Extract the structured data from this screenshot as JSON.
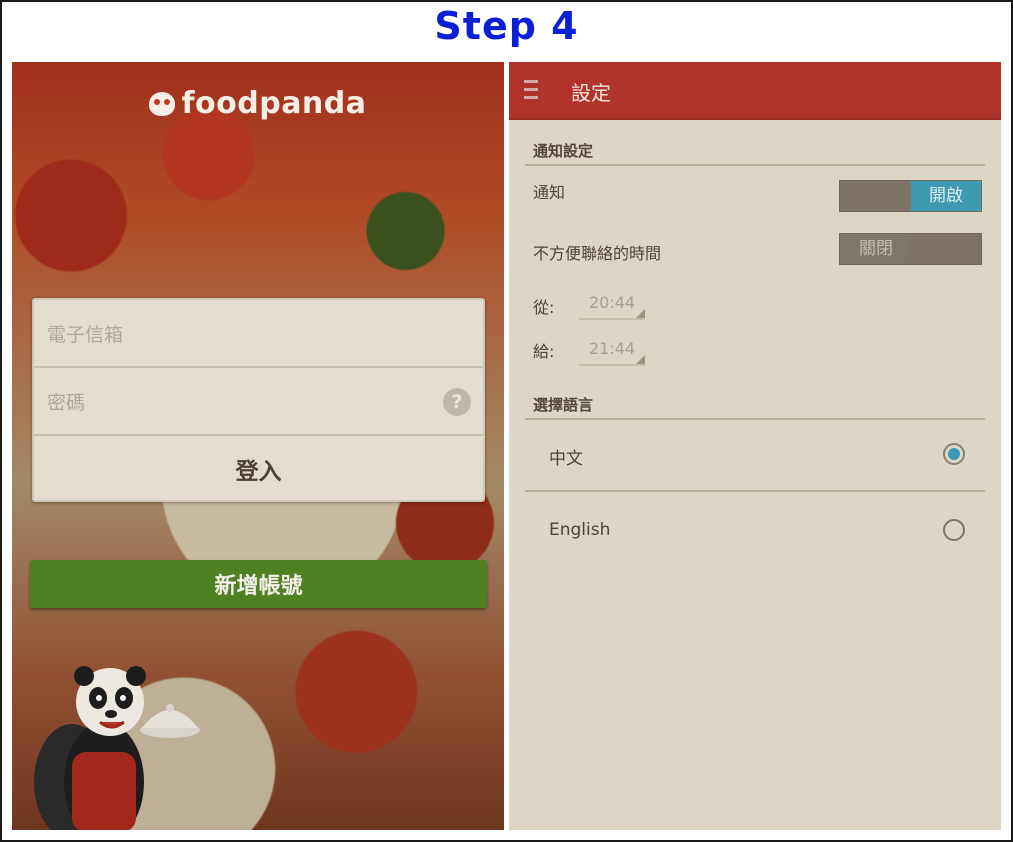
{
  "header": {
    "step_title": "Step 4"
  },
  "login": {
    "logo_text": "foodpanda",
    "email_placeholder": "電子信箱",
    "password_placeholder": "密碼",
    "help_icon_glyph": "?",
    "login_label": "登入",
    "signup_label": "新增帳號"
  },
  "settings": {
    "title": "設定",
    "notification_section": "通知設定",
    "notification_label": "通知",
    "notification_toggle": "開啟",
    "quiet_hours_label": "不方便聯絡的時間",
    "quiet_hours_toggle": "關閉",
    "from_label": "從:",
    "from_time": "20:44",
    "to_label": "給:",
    "to_time": "21:44",
    "language_section": "選擇語言",
    "languages": [
      {
        "label": "中文",
        "selected": true
      },
      {
        "label": "English",
        "selected": false
      }
    ]
  },
  "colors": {
    "step_title": "#0b1fd6",
    "appbar": "#b0332b",
    "toggle_on": "#3e99b3",
    "signup_button": "#4f8124"
  },
  "icons": [
    "menu-icon",
    "help-icon",
    "panda-mascot",
    "radio-checked-icon",
    "radio-unchecked-icon"
  ]
}
